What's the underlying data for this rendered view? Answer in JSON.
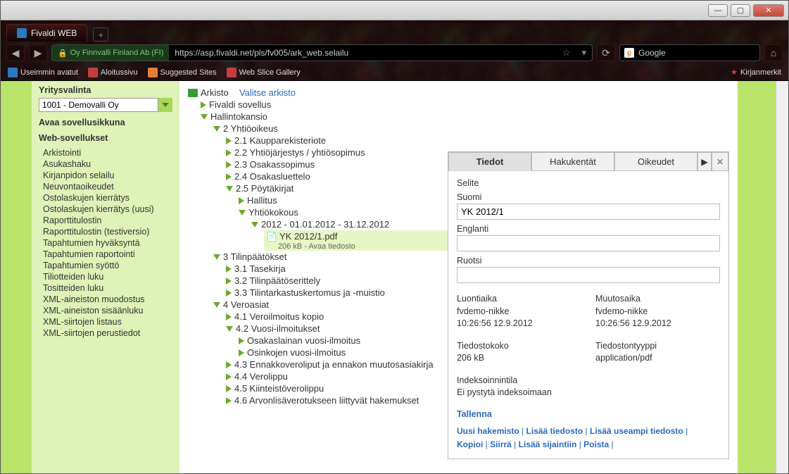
{
  "window": {
    "tab_title": "Fivaldi WEB",
    "url_identity": "Oy Finnvalli Finland Ab (FI)",
    "url": "https://asp.fivaldi.net/pls/fv005/ark_web.selailu",
    "search_placeholder": "Google"
  },
  "bookmarks": [
    "Useimmin avatut",
    "Aloitussivu",
    "Suggested Sites",
    "Web Slice Gallery"
  ],
  "bookmarks_right": "Kirjanmerkit",
  "sidebar": {
    "heading_company": "Yritysvalinta",
    "company_value": "1001 - Demovalli Oy",
    "open_app": "Avaa sovellusikkuna",
    "heading_apps": "Web-sovellukset",
    "apps": [
      "Arkistointi",
      "Asukashaku",
      "Kirjanpidon selailu",
      "Neuvontaoikeudet",
      "Ostolaskujen kierrätys",
      "Ostolaskujen kierrätys (uusi)",
      "Raporttitulostin",
      "Raporttitulostin (testiversio)",
      "Tapahtumien hyväksyntä",
      "Tapahtumien raportointi",
      "Tapahtumien syöttö",
      "Tiliotteiden luku",
      "Tositteiden luku",
      "XML-aineiston muodostus",
      "XML-aineiston sisäänluku",
      "XML-siirtojen listaus",
      "XML-siirtojen perustiedot"
    ]
  },
  "tree": {
    "root": "Arkisto",
    "choose": "Valitse arkisto",
    "app": "Fivaldi sovellus",
    "admin": "Hallintokansio",
    "s2": "2 Yhtiöoikeus",
    "s21": "2.1 Kaupparekisteriote",
    "s22": "2.2 Yhtiöjärjestys / yhtiösopimus",
    "s23": "2.3 Osakassopimus",
    "s24": "2.4 Osakasluettelo",
    "s25": "2.5 Pöytäkirjat",
    "hallitus": "Hallitus",
    "yhtiokokous": "Yhtiökokous",
    "year": "2012 - 01.01.2012 - 31.12.2012",
    "file": "YK 2012/1.pdf",
    "file_sub": "206 kB - Avaa tiedosto",
    "s3": "3 Tilinpäätökset",
    "s31": "3.1 Tasekirja",
    "s32": "3.2 Tilinpäätöserittely",
    "s33": "3.3 Tilintarkastuskertomus ja -muistio",
    "s4": "4 Veroasiat",
    "s41": "4.1 Veroilmoitus kopio",
    "s42": "4.2 Vuosi-ilmoitukset",
    "s42a": "Osakaslainan vuosi-ilmoitus",
    "s42b": "Osinkojen vuosi-ilmoitus",
    "s43": "4.3 Ennakkoveroliput ja ennakon muutosasiakirja",
    "s44": "4.4 Verolippu",
    "s45": "4.5 Kiinteistöverolippu",
    "s46": "4.6 Arvonlisäverotukseen liittyvät hakemukset"
  },
  "panel": {
    "tab1": "Tiedot",
    "tab2": "Hakukentät",
    "tab3": "Oikeudet",
    "selite": "Selite",
    "suomi_label": "Suomi",
    "suomi_value": "YK 2012/1",
    "englanti_label": "Englanti",
    "englanti_value": "",
    "ruotsi_label": "Ruotsi",
    "ruotsi_value": "",
    "created_label": "Luontiaika",
    "created_user": "fvdemo-nikke",
    "created_time": "10:26:56 12.9.2012",
    "modified_label": "Muutosaika",
    "modified_user": "fvdemo-nikke",
    "modified_time": "10:26:56 12.9.2012",
    "size_label": "Tiedostokoko",
    "size_value": "206 kB",
    "type_label": "Tiedostontyyppi",
    "type_value": "application/pdf",
    "index_label": "Indeksoinnintila",
    "index_value": "Ei pystytä indeksoimaan",
    "save": "Tallenna",
    "actions": [
      "Uusi hakemisto",
      "Lisää tiedosto",
      "Lisää useampi tiedosto",
      "Kopioi",
      "Siirrä",
      "Lisää sijaintiin",
      "Poista"
    ]
  }
}
